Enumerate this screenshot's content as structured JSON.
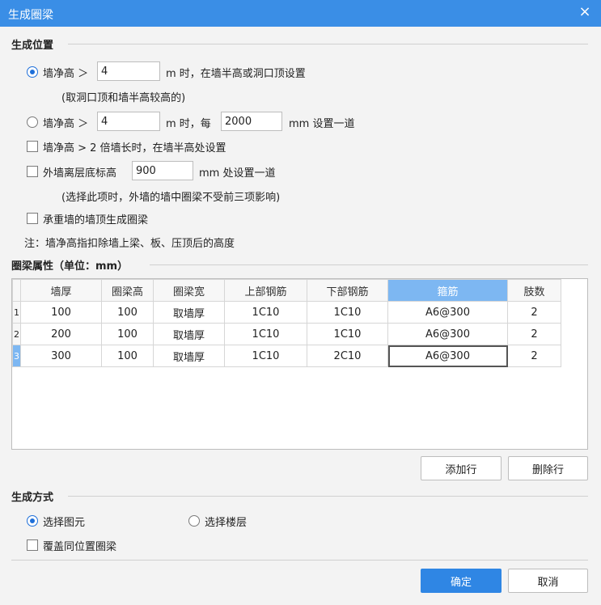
{
  "window": {
    "title": "生成圈梁",
    "close": "×"
  },
  "position_section": {
    "title": "生成位置",
    "opt1": {
      "prefix": "墙净高 ＞",
      "value": "4",
      "suffix": "m 时，在墙半高或洞口顶设置",
      "note": "(取洞口顶和墙半高较高的)"
    },
    "opt2": {
      "prefix": "墙净高 ＞",
      "value": "4",
      "mid": "m 时，每",
      "value2": "2000",
      "suffix": "mm 设置一道"
    },
    "opt3": {
      "label": "墙净高 > 2 倍墙长时，在墙半高处设置"
    },
    "opt4": {
      "prefix": "外墙离层底标高",
      "value": "900",
      "suffix": "mm 处设置一道",
      "note": "(选择此项时，外墙的墙中圈梁不受前三项影响)"
    },
    "opt5": {
      "label": "承重墙的墙顶生成圈梁"
    },
    "footnote": "注：墙净高指扣除墙上梁、板、压顶后的高度"
  },
  "props_section": {
    "title": "圈梁属性（单位：mm）",
    "columns": [
      "墙厚",
      "圈梁高",
      "圈梁宽",
      "上部钢筋",
      "下部钢筋",
      "箍筋",
      "肢数"
    ],
    "rows": [
      {
        "num": "1",
        "cells": [
          "100",
          "100",
          "取墙厚",
          "1C10",
          "1C10",
          "A6@300",
          "2"
        ]
      },
      {
        "num": "2",
        "cells": [
          "200",
          "100",
          "取墙厚",
          "1C10",
          "1C10",
          "A6@300",
          "2"
        ]
      },
      {
        "num": "3",
        "cells": [
          "300",
          "100",
          "取墙厚",
          "1C10",
          "2C10",
          "A6@300",
          "2"
        ]
      }
    ],
    "add_row": "添加行",
    "delete_row": "删除行"
  },
  "method_section": {
    "title": "生成方式",
    "select_element": "选择图元",
    "select_floor": "选择楼层",
    "overwrite": "覆盖同位置圈梁"
  },
  "footer": {
    "ok": "确定",
    "cancel": "取消"
  },
  "colors": {
    "titlebar": "#3a8ee6",
    "primary": "#2f86e4",
    "active_header": "#7db7f2"
  }
}
